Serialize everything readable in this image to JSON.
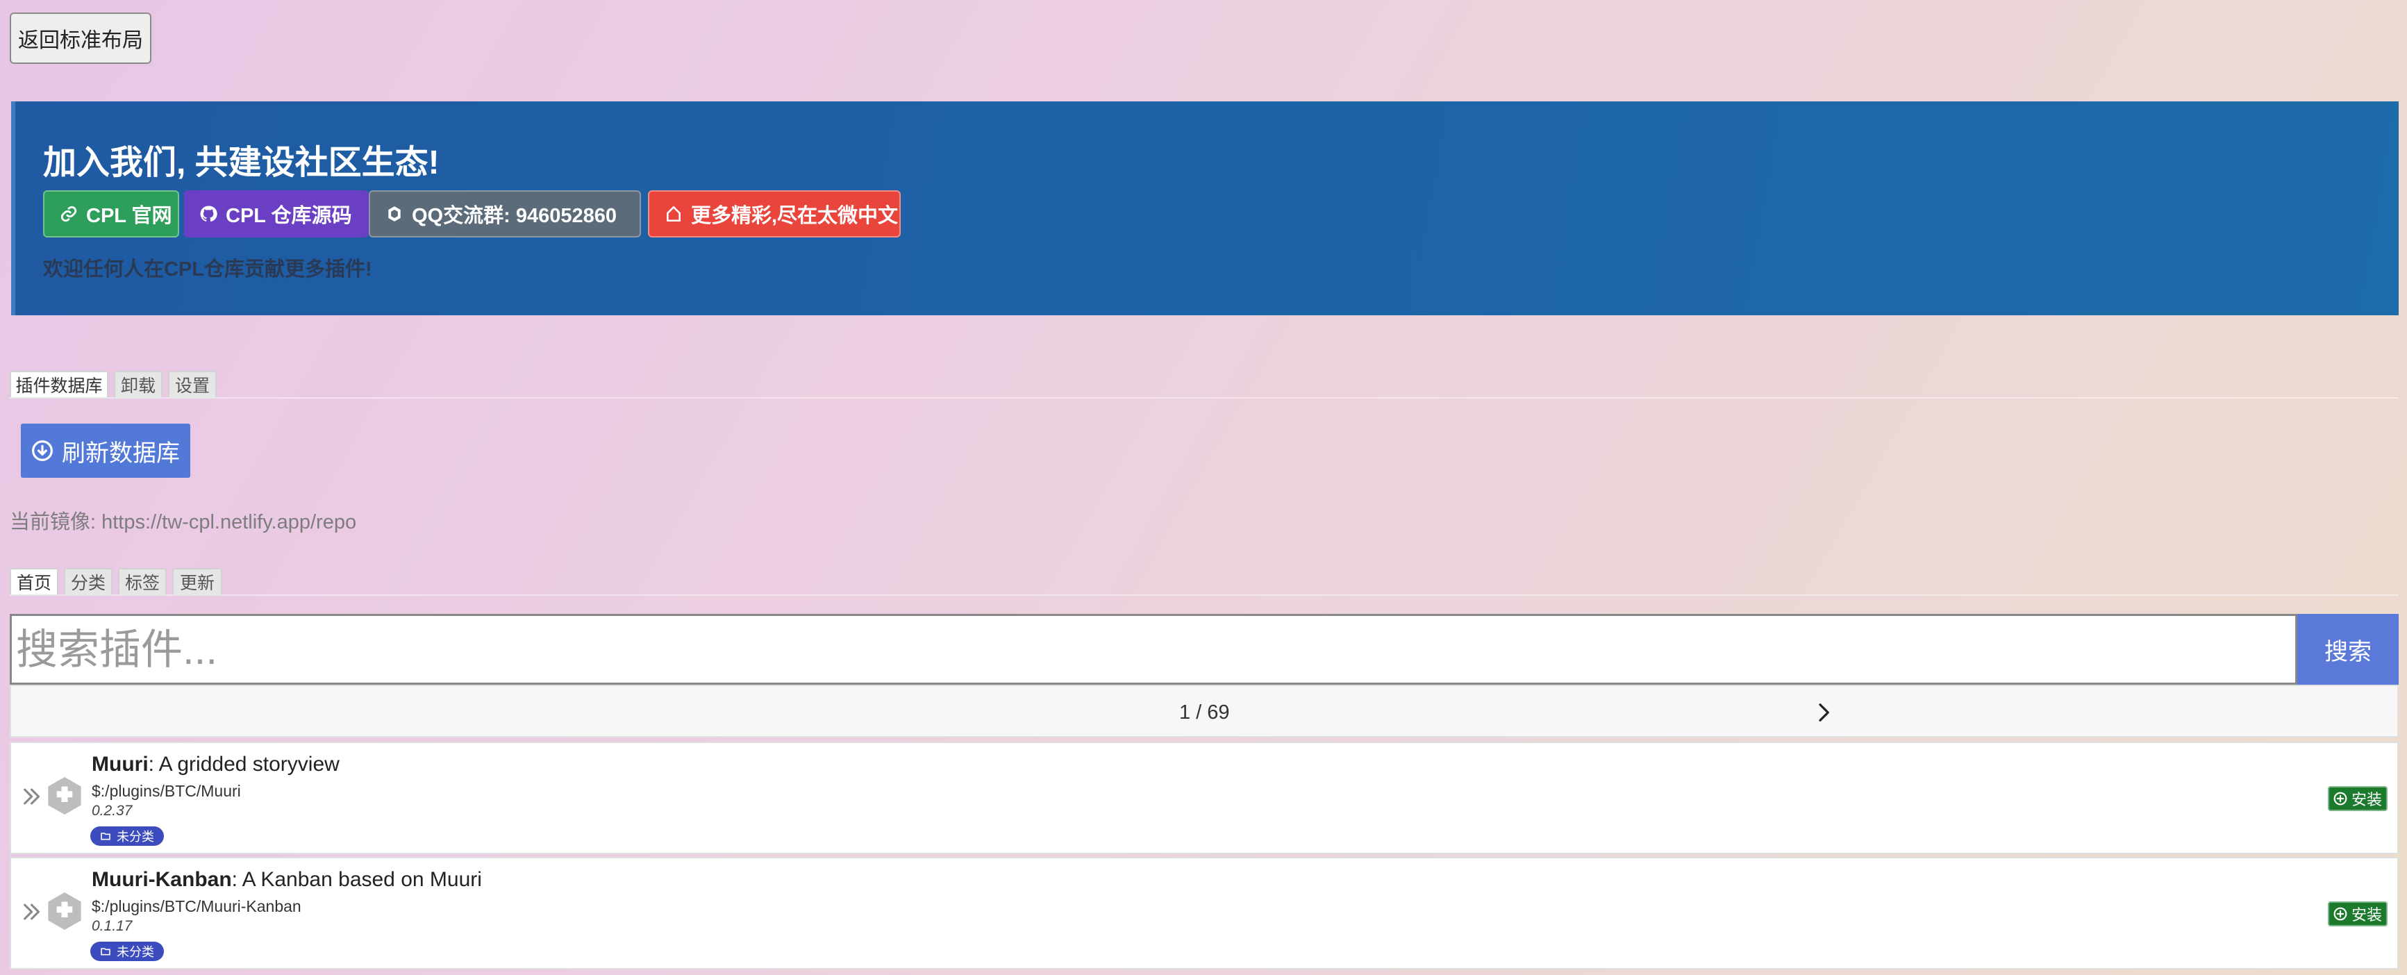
{
  "back_button": {
    "label": "返回标准布局"
  },
  "banner": {
    "title": "加入我们, 共建设社区生态!",
    "links": [
      {
        "label": "CPL 官网",
        "icon": "link-icon",
        "color": "#2e9e5b"
      },
      {
        "label": "CPL 仓库源码",
        "icon": "github-icon",
        "color": "#6a3fc4"
      },
      {
        "label": "QQ交流群: 946052860",
        "icon": "qq-icon",
        "color": "#5b6b7a"
      },
      {
        "label": "更多精彩,尽在太微中文",
        "icon": "home-icon",
        "color": "#e9453d"
      }
    ],
    "note": "欢迎任何人在CPL仓库贡献更多插件!"
  },
  "main_tabs": [
    "插件数据库",
    "卸载",
    "设置"
  ],
  "refresh_button": {
    "label": "刷新数据库",
    "icon": "refresh-icon"
  },
  "mirror": "当前镜像: https://tw-cpl.netlify.app/repo",
  "sub_tabs": [
    "首页",
    "分类",
    "标签",
    "更新"
  ],
  "search": {
    "placeholder": "搜索插件...",
    "button_label": "搜索"
  },
  "pager": {
    "label": "1 / 69"
  },
  "plugins": [
    {
      "name": "Muuri",
      "description": ": A gridded storyview",
      "path": "$:/plugins/BTC/Muuri",
      "version": "0.2.37",
      "tag": "未分类",
      "install_label": "安装"
    },
    {
      "name": "Muuri-Kanban",
      "description": ": A Kanban based on Muuri",
      "path": "$:/plugins/BTC/Muuri-Kanban",
      "version": "0.1.17",
      "tag": "未分类",
      "install_label": "安装"
    }
  ],
  "colors": {
    "accent": "#5b79d9",
    "banner": "#1e63a7",
    "tag": "#3c4bbd",
    "install": "#1b7a2c"
  }
}
